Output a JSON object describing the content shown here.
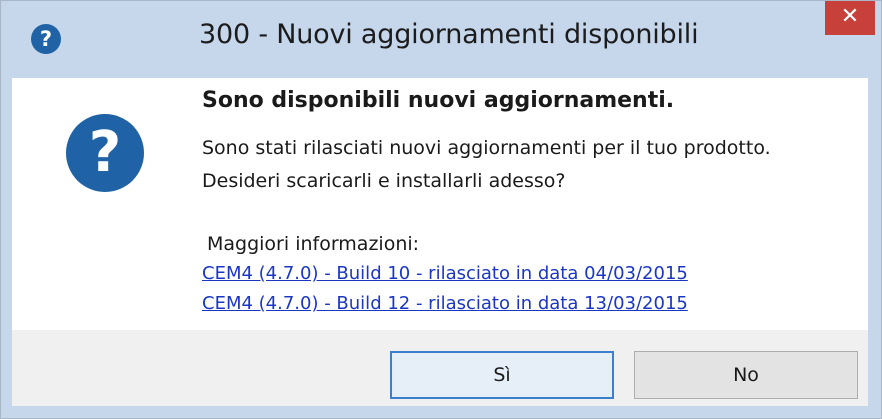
{
  "window": {
    "title": "300 - Nuovi aggiornamenti disponibili",
    "title_icon_glyph": "?",
    "close_glyph": "✕"
  },
  "content": {
    "icon_name": "question-icon",
    "icon_glyph": "?",
    "heading": "Sono disponibili nuovi aggiornamenti.",
    "message_line1": "Sono stati rilasciati nuovi aggiornamenti per il tuo prodotto.",
    "message_line2": "Desideri scaricarli e installarli adesso?",
    "more_info_label": "Maggiori  informazioni:",
    "links": [
      "CEM4 (4.7.0) - Build 10 - rilasciato in data 04/03/2015",
      "CEM4 (4.7.0) - Build 12 - rilasciato in data 13/03/2015"
    ]
  },
  "buttons": {
    "yes_label": "Sì",
    "no_label": "No"
  },
  "colors": {
    "titlebar": "#c6d6eb",
    "close": "#c7403a",
    "icon": "#1f63a6",
    "link": "#1a37c4",
    "footer": "#f0f0f0"
  }
}
